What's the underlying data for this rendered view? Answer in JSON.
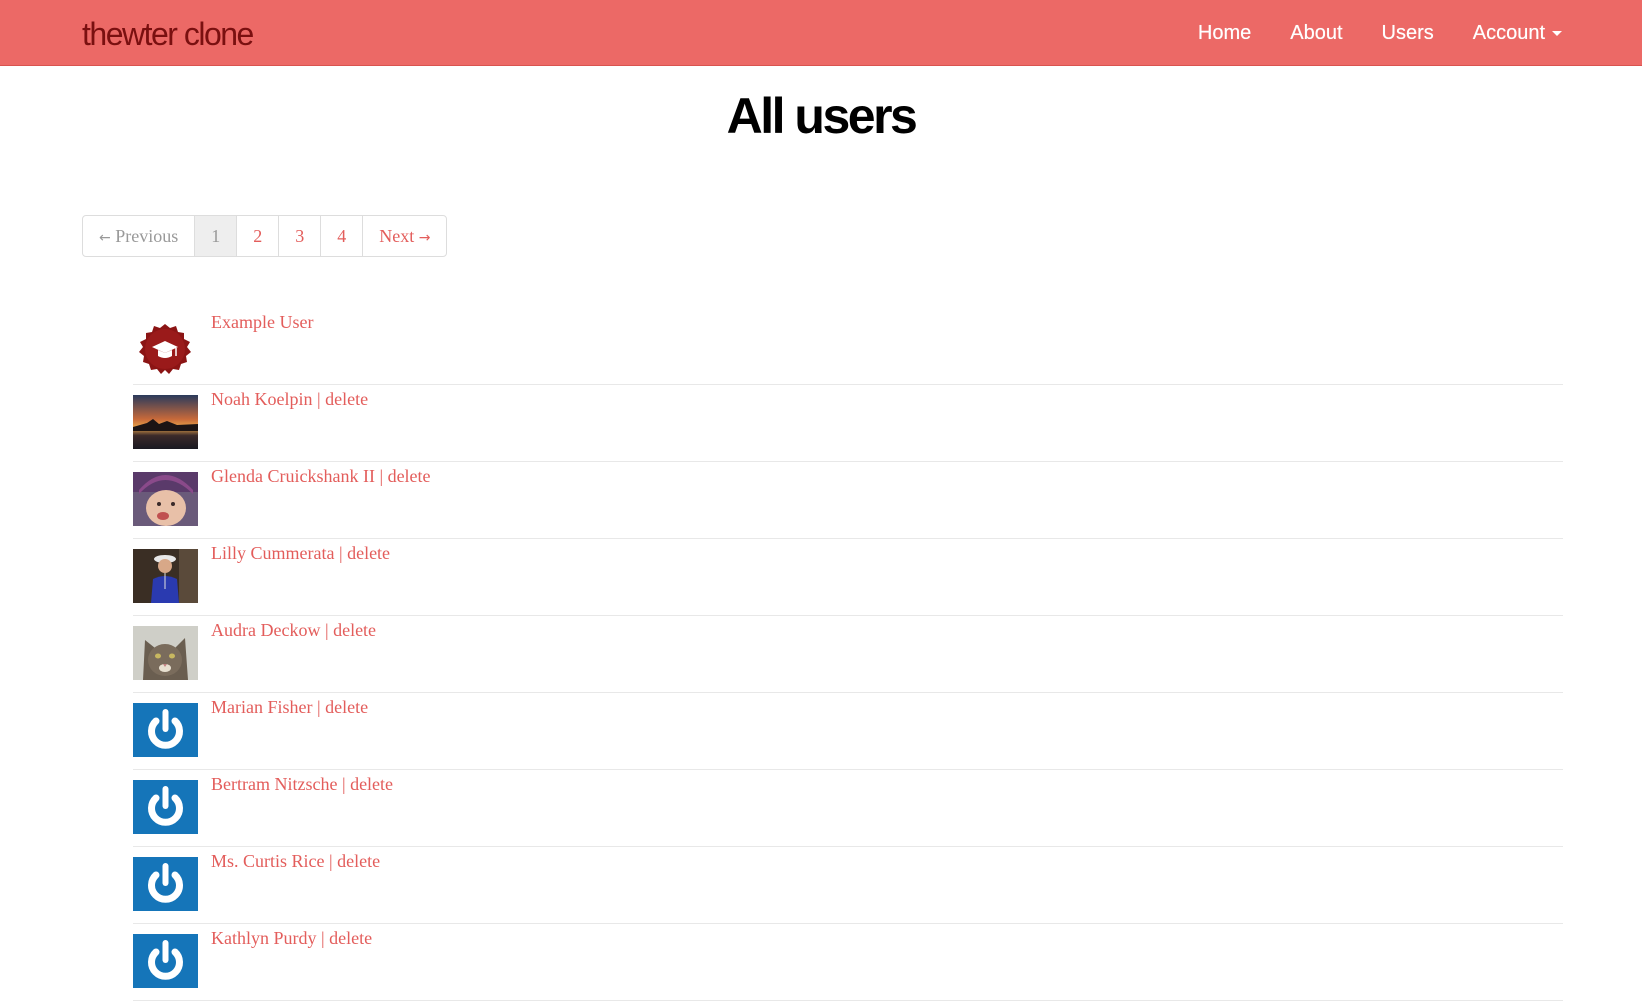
{
  "navbar": {
    "brand": "thewter clone",
    "items": [
      {
        "label": "Home"
      },
      {
        "label": "About"
      },
      {
        "label": "Users"
      },
      {
        "label": "Account"
      }
    ]
  },
  "page": {
    "title": "All users"
  },
  "pagination": {
    "previous": "Previous",
    "next": "Next",
    "prev_arrow": "←",
    "next_arrow": "→",
    "pages": [
      "1",
      "2",
      "3",
      "4"
    ],
    "current_page": "1"
  },
  "users": [
    {
      "name": "Example User",
      "separator": "",
      "delete": ""
    },
    {
      "name": "Noah Koelpin",
      "separator": " | ",
      "delete": "delete"
    },
    {
      "name": "Glenda Cruickshank II",
      "separator": " | ",
      "delete": "delete"
    },
    {
      "name": "Lilly Cummerata",
      "separator": " | ",
      "delete": "delete"
    },
    {
      "name": "Audra Deckow",
      "separator": " | ",
      "delete": "delete"
    },
    {
      "name": "Marian Fisher",
      "separator": " | ",
      "delete": "delete"
    },
    {
      "name": "Bertram Nitzsche",
      "separator": " | ",
      "delete": "delete"
    },
    {
      "name": "Ms. Curtis Rice",
      "separator": " | ",
      "delete": "delete"
    },
    {
      "name": "Kathlyn Purdy",
      "separator": " | ",
      "delete": "delete"
    }
  ],
  "colors": {
    "navbar_bg": "#ec6966",
    "brand_text": "#7a1010",
    "link": "#e35d5b",
    "gravatar_blue": "#1575b9"
  }
}
